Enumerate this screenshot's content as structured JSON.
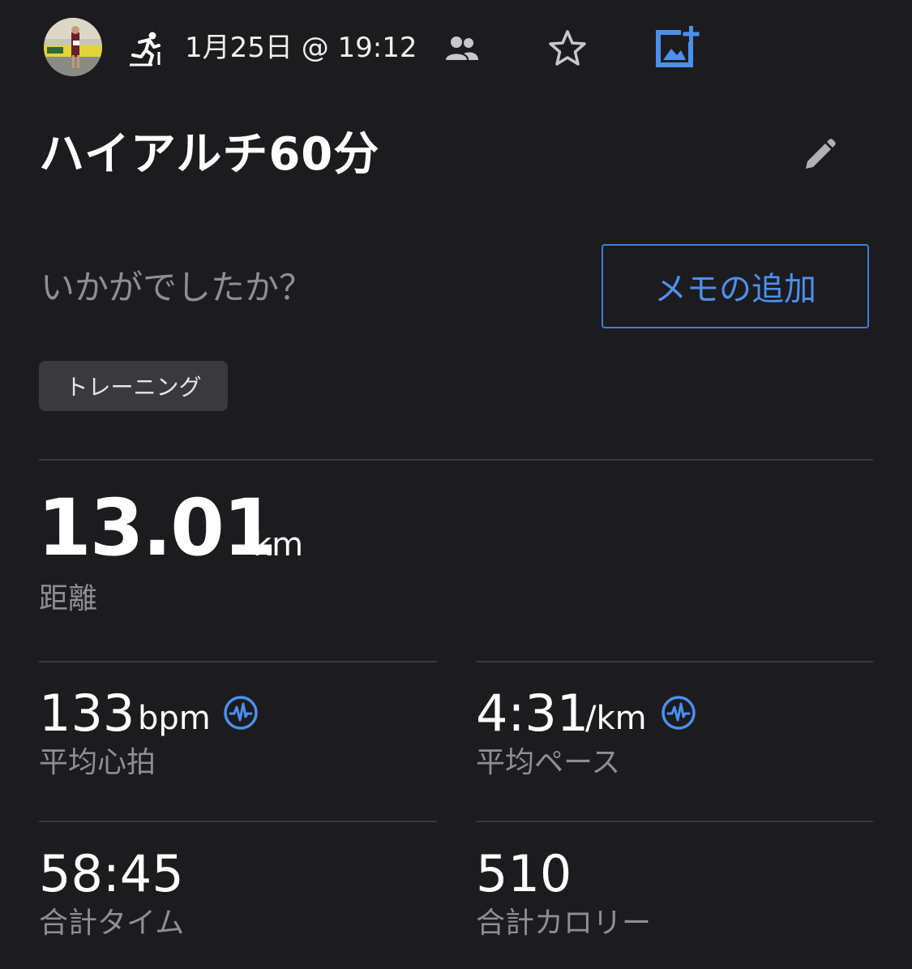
{
  "header": {
    "date_time": "1月25日 @ 19:12"
  },
  "title": "ハイアルチ60分",
  "prompt": "いかがでしたか？",
  "memo_button": "メモの追加",
  "tag": "トレーニング",
  "distance": {
    "value": "13.01",
    "unit": "km",
    "label": "距離"
  },
  "stats": {
    "heart_rate": {
      "value": "133",
      "unit": "bpm",
      "label": "平均心拍"
    },
    "pace": {
      "value": "4:31",
      "unit": "/km",
      "label": "平均ペース"
    },
    "time": {
      "value": "58:45",
      "label": "合計タイム"
    },
    "calories": {
      "value": "510",
      "label": "合計カロリー"
    }
  },
  "colors": {
    "background": "#1c1c1e",
    "accent": "#4c8ff0",
    "secondary_text": "#8e8e93",
    "tag_bg": "#3a3a3c"
  },
  "icons": {
    "activity": "running-icon",
    "group": "group-icon",
    "favorite": "star-icon",
    "add_photo": "add-photo-icon",
    "edit": "pencil-icon",
    "data_source": "heart-rate-wave-icon"
  }
}
